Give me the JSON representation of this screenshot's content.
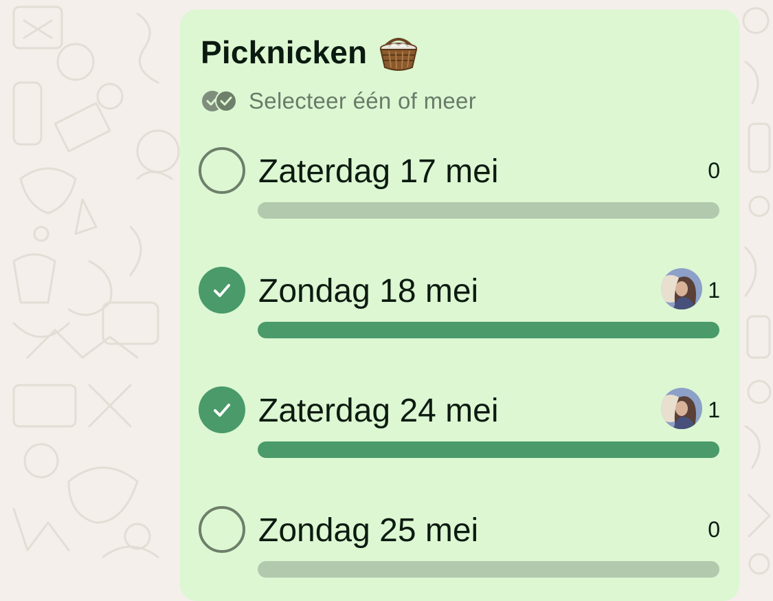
{
  "poll": {
    "title": "Picknicken",
    "title_emoji": "basket-icon",
    "subtitle": "Selecteer één of meer",
    "subtitle_icon": "double-check-icon",
    "colors": {
      "bubble": "#dcf7d2",
      "accent": "#4a9a6a",
      "track": "#b3c9ad",
      "wallpaper": "#f4efea"
    },
    "options": [
      {
        "label": "Zaterdag 17 mei",
        "votes": "0",
        "selected": false,
        "has_avatar": false,
        "fill": 0
      },
      {
        "label": "Zondag 18 mei",
        "votes": "1",
        "selected": true,
        "has_avatar": true,
        "fill": 1
      },
      {
        "label": "Zaterdag 24 mei",
        "votes": "1",
        "selected": true,
        "has_avatar": true,
        "fill": 1
      },
      {
        "label": "Zondag 25 mei",
        "votes": "0",
        "selected": false,
        "has_avatar": false,
        "fill": 0
      }
    ]
  }
}
